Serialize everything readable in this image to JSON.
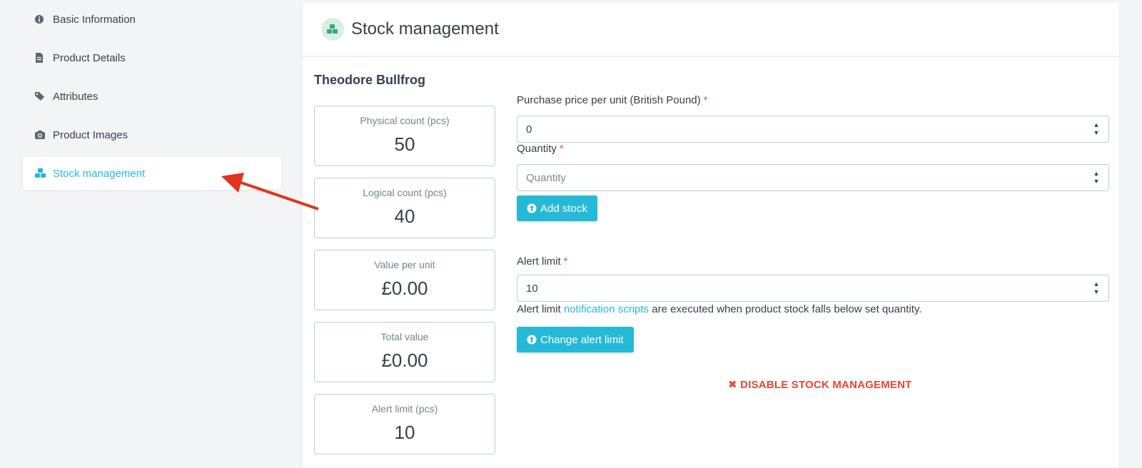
{
  "sidebar": {
    "items": [
      {
        "label": "Basic Information",
        "icon": "info-circle-icon"
      },
      {
        "label": "Product Details",
        "icon": "file-icon"
      },
      {
        "label": "Attributes",
        "icon": "tags-icon"
      },
      {
        "label": "Product Images",
        "icon": "camera-icon"
      },
      {
        "label": "Stock management",
        "icon": "cubes-icon",
        "active": true
      }
    ]
  },
  "panel": {
    "title": "Stock management",
    "product_name": "Theodore Bullfrog",
    "stats": [
      {
        "label": "Physical count (pcs)",
        "value": "50"
      },
      {
        "label": "Logical count (pcs)",
        "value": "40"
      },
      {
        "label": "Value per unit",
        "value": "£0.00"
      },
      {
        "label": "Total value",
        "value": "£0.00"
      },
      {
        "label": "Alert limit (pcs)",
        "value": "10"
      }
    ],
    "purchase_price": {
      "label": "Purchase price per unit (British Pound)",
      "required": "*",
      "value": "0"
    },
    "quantity": {
      "label": "Quantity",
      "required": "*",
      "placeholder": "Quantity"
    },
    "add_stock_label": "Add stock",
    "alert_limit": {
      "label": "Alert limit",
      "required": "*",
      "value": "10"
    },
    "alert_help": {
      "prefix": "Alert limit",
      "link": "notification scripts",
      "suffix": "are executed when product stock falls below set quantity."
    },
    "change_alert_label": "Change alert limit",
    "disable_label": "DISABLE STOCK MANAGEMENT"
  },
  "colors": {
    "accent": "#25b9d7",
    "danger": "#e84535",
    "annotation_arrow": "#e0341f"
  }
}
